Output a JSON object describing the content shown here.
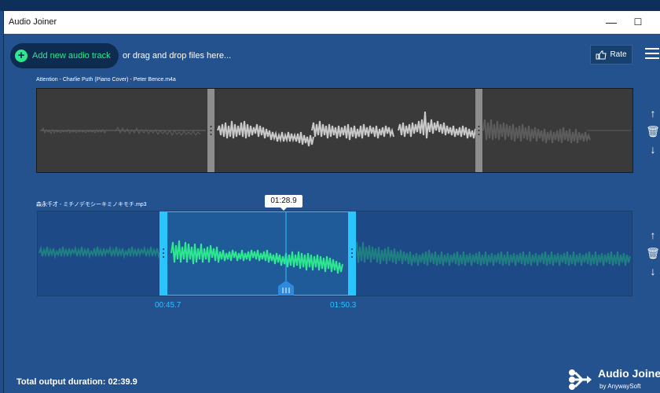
{
  "window": {
    "title": "Audio Joiner",
    "minimize": "—",
    "maximize": "☐"
  },
  "toolbar": {
    "add_track_label": "Add new audio track",
    "drag_hint": "or drag and drop files here...",
    "rate_label": "Rate"
  },
  "tracks": [
    {
      "name": "Attention - Charlie Puth (Piano Cover) - Peter Bence.m4a"
    },
    {
      "name": "森永千才 - ミチノデモシーキミノキモチ.mp3",
      "current_time": "01:28.9",
      "start_time": "00:45.7",
      "end_time": "01:50.3"
    }
  ],
  "side_icons": [
    "arrow-up-icon",
    "trash-icon",
    "arrow-down-icon"
  ],
  "footer": {
    "total_output": "Total output duration: 02:39.9",
    "brand_name": "Audio Joiner",
    "brand_by": "by AnywaySoft"
  },
  "colors": {
    "background": "#23528f",
    "accent_green": "#2de88e",
    "accent_cyan": "#29c5ff",
    "waveform_gray": "#b0b0b0",
    "waveform_teal": "#1f7f83"
  }
}
